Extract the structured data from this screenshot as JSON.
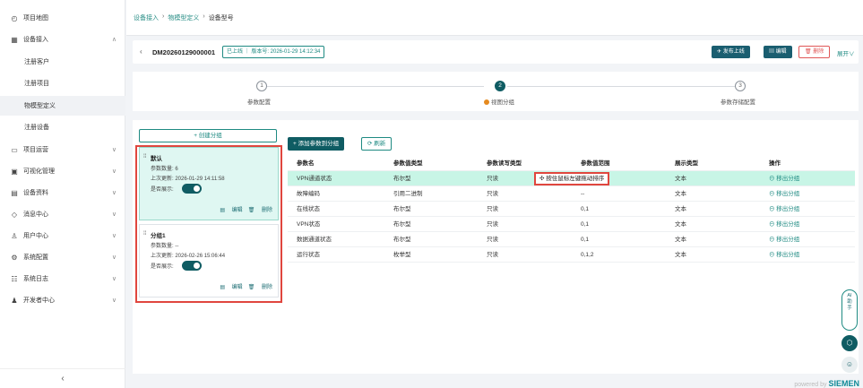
{
  "sidebar": {
    "items": [
      {
        "label": "项目地图",
        "icon": "dashboard-icon",
        "glyph": "◴",
        "chevron": false
      },
      {
        "label": "设备接入",
        "icon": "device-access-icon",
        "glyph": "▦",
        "chevron": true,
        "expanded": true
      },
      {
        "label": "项目运营",
        "icon": "folder-icon",
        "glyph": "▭",
        "chevron": true
      },
      {
        "label": "可视化管理",
        "icon": "monitor-icon",
        "glyph": "▣",
        "chevron": true
      },
      {
        "label": "设备资料",
        "icon": "document-icon",
        "glyph": "▤",
        "chevron": true
      },
      {
        "label": "消息中心",
        "icon": "bell-icon",
        "glyph": "◇",
        "chevron": true
      },
      {
        "label": "用户中心",
        "icon": "user-icon",
        "glyph": "♙",
        "chevron": true
      },
      {
        "label": "系统配置",
        "icon": "settings-icon",
        "glyph": "⚙",
        "chevron": true
      },
      {
        "label": "系统日志",
        "icon": "log-icon",
        "glyph": "☷",
        "chevron": true
      },
      {
        "label": "开发者中心",
        "icon": "developer-icon",
        "glyph": "♟",
        "chevron": true
      }
    ],
    "subitems": [
      "注册客户",
      "注册项目",
      "物模型定义",
      "注册设备"
    ],
    "collapse": "‹"
  },
  "breadcrumb": [
    "设备接入",
    "物模型定义",
    "设备型号"
  ],
  "header": {
    "back": "‹",
    "device_id": "DM20260129000001",
    "tag": "已上线 ｜ 版本号: 2026-01-29 14:12:34",
    "publish": "✈ 发布上线",
    "edit": "▤ 编辑",
    "delete": "🗑 删除",
    "expand": "展开∨"
  },
  "steps": [
    {
      "num": "1",
      "label": "参数配置"
    },
    {
      "num": "2",
      "label": "视图分组",
      "active": true
    },
    {
      "num": "3",
      "label": "参数存储配置"
    }
  ],
  "groups": {
    "add_button": "+ 创建分组",
    "list": [
      {
        "name": "默认",
        "count_label": "参数数量:",
        "count": "6",
        "updated_label": "上次更新:",
        "updated": "2026-01-29 14:11:58",
        "show_label": "是否展示:",
        "edit": "编辑",
        "delete": "删除"
      },
      {
        "name": "分组1",
        "count_label": "参数数量:",
        "count": "--",
        "updated_label": "上次更新:",
        "updated": "2026-02-26 15:06:44",
        "show_label": "是否展示:",
        "edit": "编辑",
        "delete": "删除"
      }
    ]
  },
  "toolbar": {
    "add_param": "+ 添加参数到分组",
    "refresh": "⟳ 刷新"
  },
  "table": {
    "headers": [
      "参数名",
      "参数值类型",
      "参数读写类型",
      "参数值范围",
      "展示类型",
      "操作"
    ],
    "drag_hint": "✣ 按住鼠标左键拖动排序",
    "rows": [
      [
        "VPN通道状态",
        "布尔型",
        "只读",
        "",
        "文本",
        "⊖ 移出分组"
      ],
      [
        "故障编码",
        "引用二进制",
        "只读",
        "--",
        "文本",
        "⊖ 移出分组"
      ],
      [
        "在线状态",
        "布尔型",
        "只读",
        "0,1",
        "文本",
        "⊖ 移出分组"
      ],
      [
        "VPN状态",
        "布尔型",
        "只读",
        "0,1",
        "文本",
        "⊖ 移出分组"
      ],
      [
        "数据通道状态",
        "布尔型",
        "只读",
        "0,1",
        "文本",
        "⊖ 移出分组"
      ],
      [
        "运行状态",
        "枚举型",
        "只读",
        "0,1,2",
        "文本",
        "⊖ 移出分组"
      ]
    ]
  },
  "ai": {
    "label": "AI\n助\n手"
  },
  "footer": {
    "prefix": "powered by",
    "brand": "SIEMEN"
  }
}
